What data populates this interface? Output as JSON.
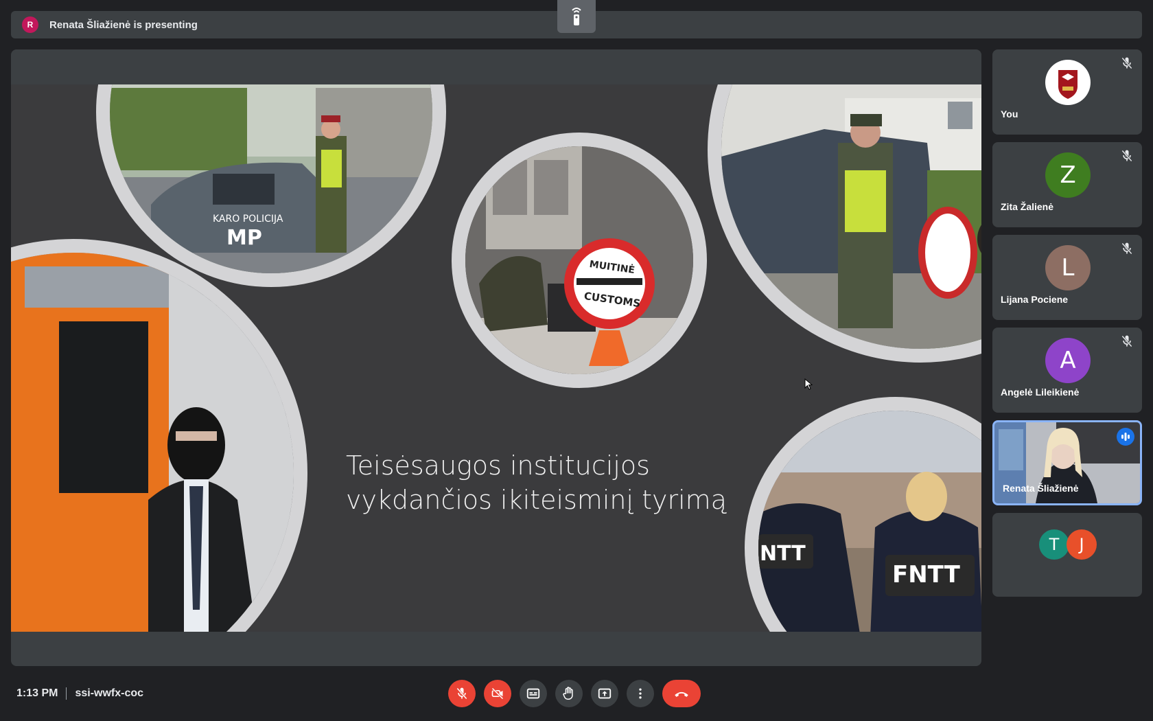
{
  "presenting_bar": {
    "avatar_letter": "R",
    "text": "Renata Šliažienė is presenting"
  },
  "slide": {
    "title_line1": "Teisėsaugos institucijos",
    "title_line2": "vykdančios ikiteisminį tyrimą",
    "photos": [
      {
        "label_line1": "KARO POLICIJA",
        "label_line2": "MP"
      },
      {
        "label_line1": "MUITINĖ",
        "label_line2": "CUSTOMS"
      },
      {
        "label_line1": "",
        "label_line2": ""
      },
      {
        "label_line1": "",
        "label_line2": ""
      },
      {
        "label_line1": "FNTT",
        "label_line2": "NTT"
      }
    ]
  },
  "participants": [
    {
      "name": "You",
      "avatar": "",
      "color": "#ffffff",
      "muted": true
    },
    {
      "name": "Zita Žalienė",
      "avatar": "Z",
      "color": "#3f7d20",
      "muted": true
    },
    {
      "name": "Lijana Pociene",
      "avatar": "L",
      "color": "#8d6e63",
      "muted": true
    },
    {
      "name": "Angelė Lileikienė",
      "avatar": "A",
      "color": "#8e44c9",
      "muted": true
    },
    {
      "name": "Renata Šliažienė",
      "avatar": "",
      "color": "#8ab4f8",
      "muted": false
    },
    {
      "name": "",
      "avatar_group": [
        "T",
        "J"
      ],
      "colors": [
        "#188f7a",
        "#e8502a"
      ]
    }
  ],
  "bottom": {
    "time": "1:13 PM",
    "meeting_code": "ssi-wwfx-coc"
  },
  "controls": [
    "mic-off",
    "camera-off",
    "captions",
    "raise-hand",
    "present",
    "more-options",
    "leave-call"
  ],
  "colors": {
    "background": "#202124",
    "surface": "#3c4043",
    "danger": "#ea4335",
    "accent": "#8ab4f8"
  }
}
